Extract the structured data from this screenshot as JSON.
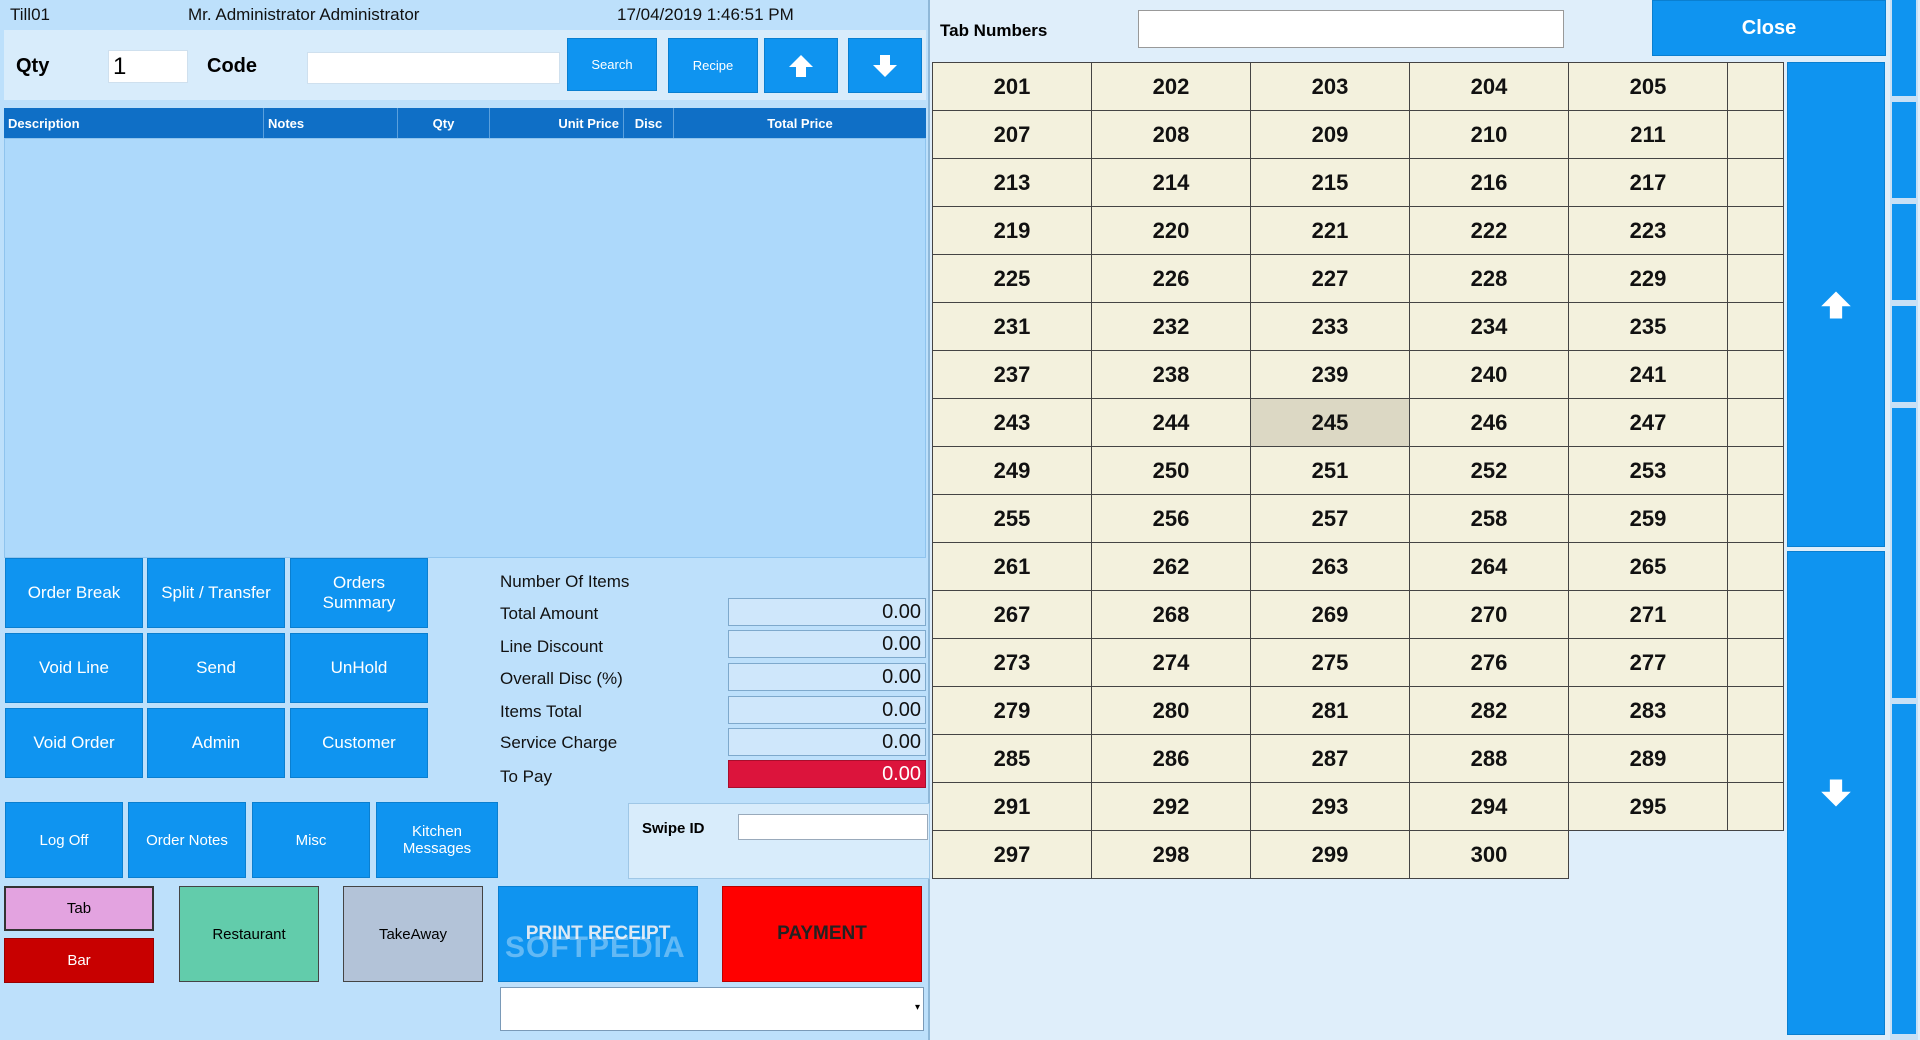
{
  "header": {
    "till": "Till01",
    "user": "Mr. Administrator Administrator",
    "datetime": "17/04/2019 1:46:51 PM"
  },
  "entry": {
    "qty_label": "Qty",
    "qty_value": "1",
    "code_label": "Code",
    "code_value": "",
    "search_label": "Search",
    "recipe_label": "Recipe"
  },
  "grid": {
    "columns": [
      "Description",
      "Notes",
      "Qty",
      "Unit Price",
      "Disc",
      "Total Price"
    ]
  },
  "actions": {
    "order_break": "Order Break",
    "split_transfer": "Split / Transfer",
    "orders_summary": "Orders Summary",
    "void_line": "Void Line",
    "send": "Send",
    "unhold": "UnHold",
    "void_order": "Void Order",
    "admin": "Admin",
    "customer": "Customer",
    "log_off": "Log Off",
    "order_notes": "Order Notes",
    "misc": "Misc",
    "kitchen_messages": "Kitchen Messages"
  },
  "totals": {
    "number_of_items_label": "Number Of Items",
    "total_amount_label": "Total Amount",
    "total_amount": "0.00",
    "line_discount_label": "Line Discount",
    "line_discount": "0.00",
    "overall_disc_label": "Overall Disc (%)",
    "overall_disc": "0.00",
    "items_total_label": "Items Total",
    "items_total": "0.00",
    "service_charge_label": "Service Charge",
    "service_charge": "0.00",
    "to_pay_label": "To Pay",
    "to_pay": "0.00"
  },
  "swipe": {
    "label": "Swipe ID",
    "value": ""
  },
  "modes": {
    "tab": "Tab",
    "bar": "Bar",
    "restaurant": "Restaurant",
    "takeaway": "TakeAway"
  },
  "bottom": {
    "print_receipt": "PRINT RECEIPT",
    "payment": "PAYMENT",
    "watermark": "SOFTPEDIA"
  },
  "tab_panel": {
    "title": "Tab Numbers",
    "search_value": "",
    "close_label": "Close",
    "selected": "245",
    "numbers": [
      "201",
      "202",
      "203",
      "204",
      "205",
      "207",
      "208",
      "209",
      "210",
      "211",
      "213",
      "214",
      "215",
      "216",
      "217",
      "219",
      "220",
      "221",
      "222",
      "223",
      "225",
      "226",
      "227",
      "228",
      "229",
      "231",
      "232",
      "233",
      "234",
      "235",
      "237",
      "238",
      "239",
      "240",
      "241",
      "243",
      "244",
      "245",
      "246",
      "247",
      "249",
      "250",
      "251",
      "252",
      "253",
      "255",
      "256",
      "257",
      "258",
      "259",
      "261",
      "262",
      "263",
      "264",
      "265",
      "267",
      "268",
      "269",
      "270",
      "271",
      "273",
      "274",
      "275",
      "276",
      "277",
      "279",
      "280",
      "281",
      "282",
      "283",
      "285",
      "286",
      "287",
      "288",
      "289",
      "291",
      "292",
      "293",
      "294",
      "295",
      "297",
      "298",
      "299",
      "300"
    ]
  },
  "colors": {
    "accent_blue": "#0f94f0",
    "to_pay_red": "#dc143c",
    "payment_red": "#ff0000",
    "tab_pink": "#e3a3e0",
    "bar_red": "#c80000",
    "restaurant_green": "#62ccab",
    "takeaway_grey": "#b3c3d8",
    "cell_beige": "#f3f1dd"
  },
  "icons": {
    "up": "arrow-up-icon",
    "down": "arrow-down-icon"
  }
}
